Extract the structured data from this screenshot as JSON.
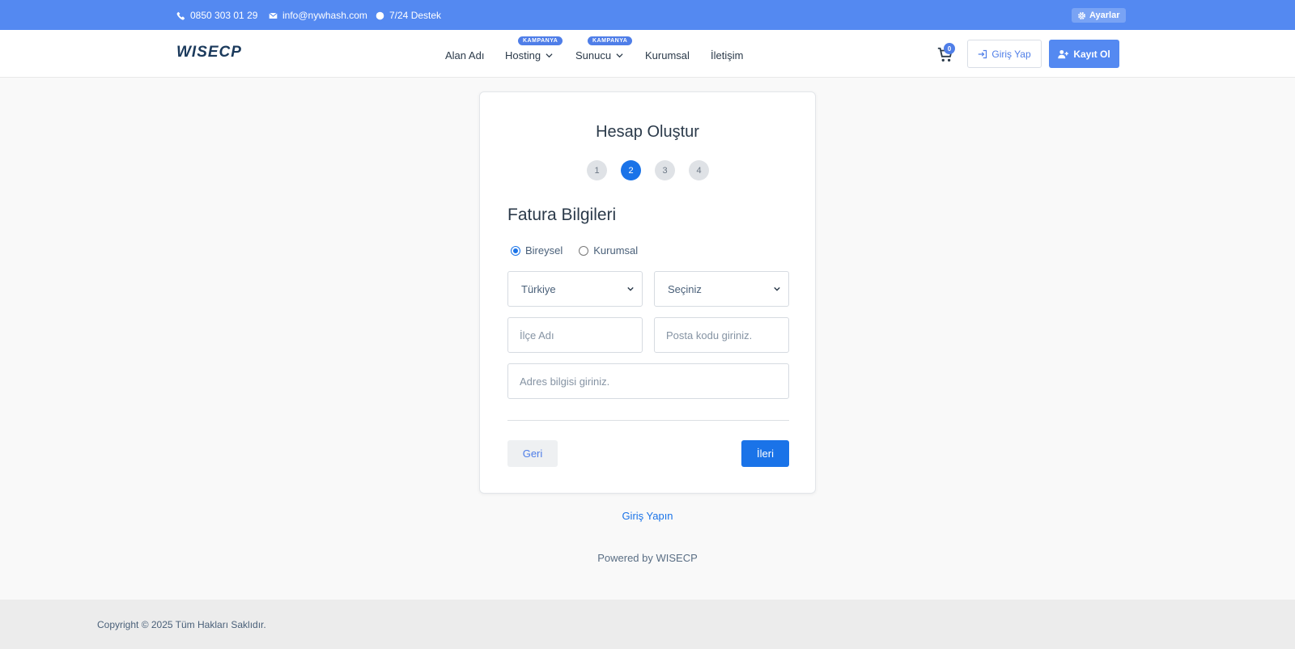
{
  "topbar": {
    "phone": "0850 303 01 29",
    "email": "info@nywhash.com",
    "support": "7/24 Destek",
    "settings_label": "Ayarlar"
  },
  "header": {
    "logo_text": "WISECP",
    "nav": [
      {
        "label": "Alan Adı"
      },
      {
        "label": "Hosting",
        "badge": "KAMPANYA"
      },
      {
        "label": "Sunucu",
        "badge": "KAMPANYA"
      },
      {
        "label": "Kurumsal"
      },
      {
        "label": "İletişim"
      }
    ],
    "cart_count": "0",
    "login_label": "Giriş Yap",
    "register_label": "Kayıt Ol"
  },
  "form": {
    "title": "Hesap Oluştur",
    "steps": [
      "1",
      "2",
      "3",
      "4"
    ],
    "active_step": 2,
    "section_title": "Fatura Bilgileri",
    "account_types": [
      "Bireysel",
      "Kurumsal"
    ],
    "selected_account_type": "Bireysel",
    "country_value": "Türkiye",
    "city_value": "Seçiniz",
    "district_placeholder": "İlçe Adı",
    "postcode_placeholder": "Posta kodu giriniz.",
    "address_placeholder": "Adres bilgisi giriniz.",
    "back_label": "Geri",
    "next_label": "İleri"
  },
  "login_link": "Giriş Yapın",
  "powered_by": "Powered by WISECP",
  "footer": {
    "copyright": "Copyright © 2025 Tüm Hakları Saklıdır."
  },
  "colors": {
    "topbar": "#5489f1",
    "primary": "#1a73e8",
    "logo": "#1b3a5c"
  }
}
